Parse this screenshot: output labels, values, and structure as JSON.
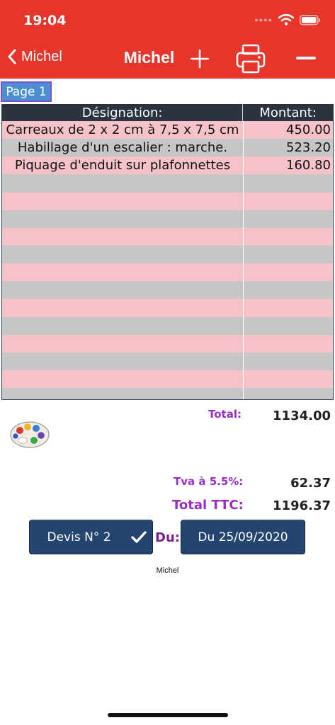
{
  "status": {
    "time": "19:04"
  },
  "nav": {
    "back_label": "Michel",
    "title": "Michel"
  },
  "page_tab": "Page 1",
  "table": {
    "headers": [
      "Désignation:",
      "Montant:"
    ],
    "rows": [
      [
        "Carreaux de 2 x 2 cm à 7,5 x 7,5 cm",
        "450.00"
      ],
      [
        "Habillage d'un escalier : marche.",
        "523.20"
      ],
      [
        "Piquage d'enduit sur plafonnettes",
        "160.80"
      ],
      [
        "",
        ""
      ],
      [
        "",
        ""
      ],
      [
        "",
        ""
      ],
      [
        "",
        ""
      ],
      [
        "",
        ""
      ],
      [
        "",
        ""
      ],
      [
        "",
        ""
      ],
      [
        "",
        ""
      ],
      [
        "",
        ""
      ],
      [
        "",
        ""
      ],
      [
        "",
        ""
      ],
      [
        "",
        ""
      ],
      [
        "",
        ""
      ],
      [
        "",
        ""
      ]
    ]
  },
  "totals": {
    "total_label": "Total:",
    "total_value": "1134.00",
    "tva_label": "Tva à 5.5%:",
    "tva_value": "62.37",
    "ttc_label": "Total TTC:",
    "ttc_value": "1196.37"
  },
  "devis": {
    "label": "Devis N° 2",
    "du_label": "Du:",
    "date_label": "Du 25/09/2020"
  },
  "footer": {
    "name": "Michel"
  },
  "colors": {
    "header": "#e8352b",
    "row_pink": "#f6c2c9",
    "row_grey": "#c6c6c6",
    "accent_purple": "#9a2ec2",
    "button": "#24456f"
  }
}
